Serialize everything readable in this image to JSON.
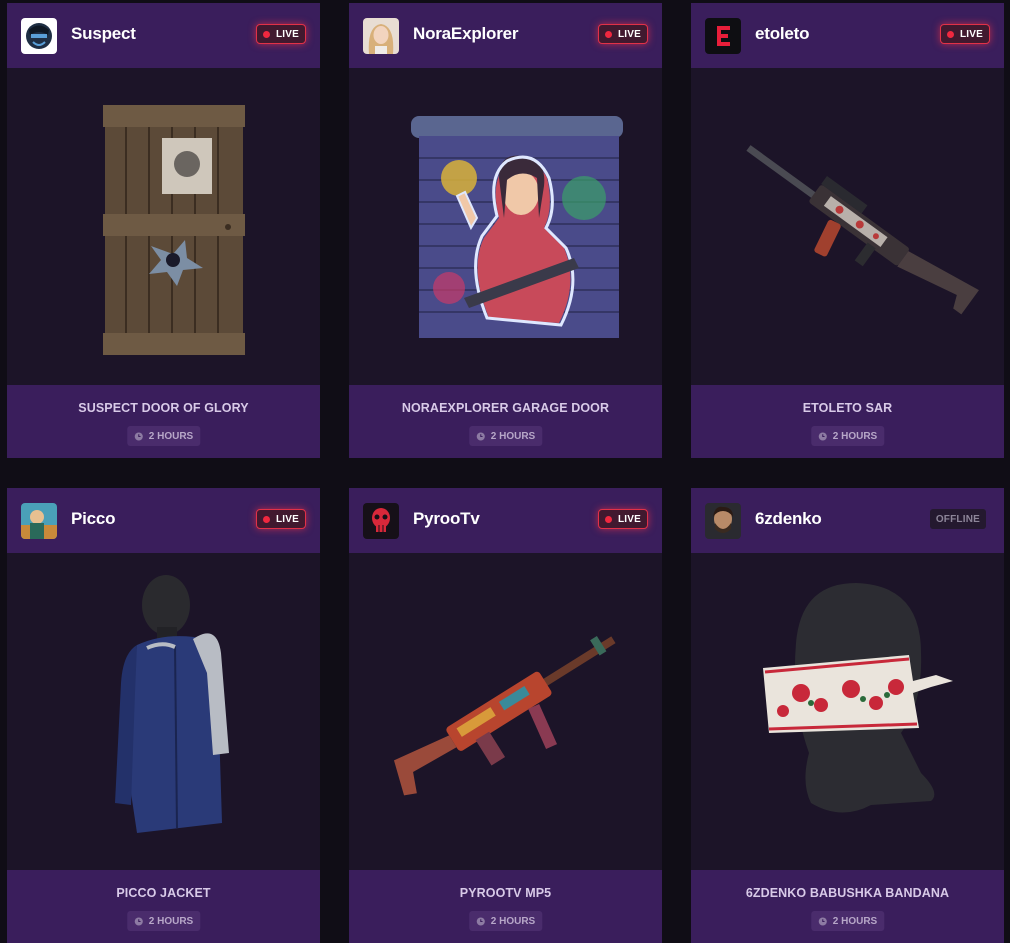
{
  "colors": {
    "page_bg": "#100d16",
    "card_bg": "#1c1428",
    "header_bg": "#3a1e5c",
    "live_red": "#e23148"
  },
  "cards": [
    {
      "streamer": "Suspect",
      "status": "LIVE",
      "item": "SUSPECT DOOR OF GLORY",
      "duration": "2 HOURS",
      "avatar_icon": "suspect-avatar",
      "item_icon": "wooden-door-icon"
    },
    {
      "streamer": "NoraExplorer",
      "status": "LIVE",
      "item": "NORAEXPLORER GARAGE DOOR",
      "duration": "2 HOURS",
      "avatar_icon": "noraexplorer-avatar",
      "item_icon": "garage-door-icon"
    },
    {
      "streamer": "etoleto",
      "status": "LIVE",
      "item": "ETOLETO SAR",
      "duration": "2 HOURS",
      "avatar_icon": "etoleto-logo-avatar",
      "item_icon": "rifle-icon"
    },
    {
      "streamer": "Picco",
      "status": "LIVE",
      "item": "PICCO JACKET",
      "duration": "2 HOURS",
      "avatar_icon": "picco-avatar",
      "item_icon": "jacket-icon"
    },
    {
      "streamer": "PyrooTv",
      "status": "LIVE",
      "item": "PYROOTV MP5",
      "duration": "2 HOURS",
      "avatar_icon": "pyrootv-skull-avatar",
      "item_icon": "smg-icon"
    },
    {
      "streamer": "6zdenko",
      "status": "OFFLINE",
      "item": "6ZDENKO BABUSHKA BANDANA",
      "duration": "2 HOURS",
      "avatar_icon": "6zdenko-avatar",
      "item_icon": "bandana-icon"
    }
  ]
}
